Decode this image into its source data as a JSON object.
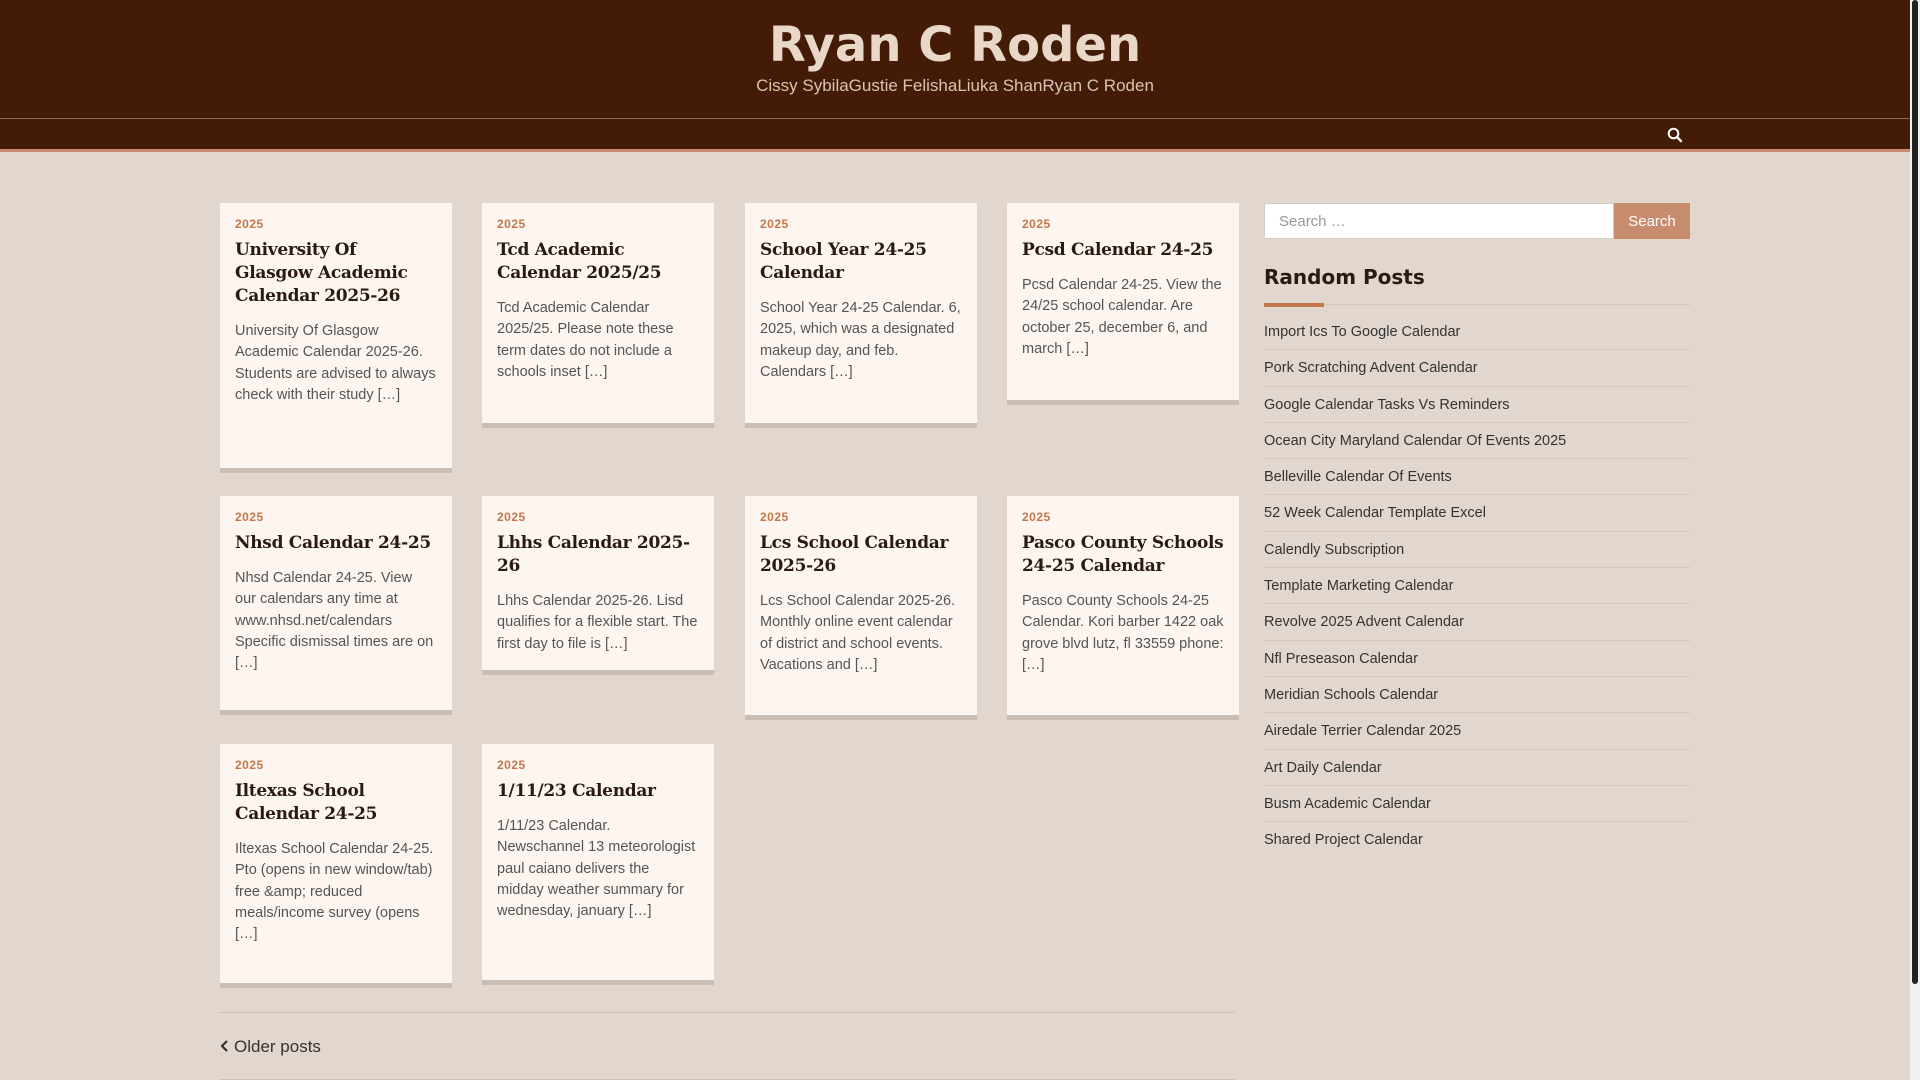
{
  "site": {
    "title": "Ryan C Roden",
    "description": "Cissy SybilaGustie FelishaLiuka ShanRyan C Roden"
  },
  "nav": {
    "search_icon": "search-icon"
  },
  "posts": [
    {
      "category": "2025",
      "title": "University Of Glasgow Academic Calendar 2025-26",
      "excerpt": "University Of Glasgow Academic Calendar 2025-26. Students are advised to always check with their study […]"
    },
    {
      "category": "2025",
      "title": "Tcd Academic Calendar 2025/25",
      "excerpt": "Tcd Academic Calendar 2025/25. Please note these term dates do not include a schools inset […]"
    },
    {
      "category": "2025",
      "title": "School Year 24-25 Calendar",
      "excerpt": "School Year 24-25 Calendar. 6, 2025, which was a designated makeup day, and feb. Calendars […]"
    },
    {
      "category": "2025",
      "title": "Pcsd Calendar 24-25",
      "excerpt": "Pcsd Calendar 24-25. View the 24/25 school calendar. Are october 25, december 6, and march […]"
    },
    {
      "category": "2025",
      "title": "Nhsd Calendar 24-25",
      "excerpt": "Nhsd Calendar 24-25. View our calendars any time at www.nhsd.net/calendars Specific dismissal times are on […]"
    },
    {
      "category": "2025",
      "title": "Lhhs Calendar 2025-26",
      "excerpt": "Lhhs Calendar 2025-26. Lisd qualifies for a flexible start. The first day to file is […]"
    },
    {
      "category": "2025",
      "title": "Lcs School Calendar 2025-26",
      "excerpt": "Lcs School Calendar 2025-26. Monthly online event calendar of district and school events. Vacations and […]"
    },
    {
      "category": "2025",
      "title": "Pasco County Schools 24-25 Calendar",
      "excerpt": "Pasco County Schools 24-25 Calendar. Kori barber 1422 oak grove blvd lutz, fl 33559 phone: […]"
    },
    {
      "category": "2025",
      "title": "Iltexas School Calendar 24-25",
      "excerpt": "Iltexas School Calendar 24-25. Pto (opens in new window/tab) free &amp; reduced meals/income survey (opens […]"
    },
    {
      "category": "2025",
      "title": "1/11/23 Calendar",
      "excerpt": "1/11/23 Calendar. Newschannel 13 meteorologist paul caiano delivers the midday weather summary for wednesday, january […]"
    }
  ],
  "pagination": {
    "older_label": "Older posts",
    "chevron_icon": "chevron-left-icon"
  },
  "sidebar": {
    "search": {
      "placeholder": "Search …",
      "button_label": "Search"
    },
    "random_posts_title": "Random Posts",
    "random_posts": [
      "Import Ics To Google Calendar",
      "Pork Scratching Advent Calendar",
      "Google Calendar Tasks Vs Reminders",
      "Ocean City Maryland Calendar Of Events 2025",
      "Belleville Calendar Of Events",
      "52 Week Calendar Template Excel",
      "Calendly Subscription",
      "Template Marketing Calendar",
      "Revolve 2025 Advent Calendar",
      "Nfl Preseason Calendar",
      "Meridian Schools Calendar",
      "Airedale Terrier Calendar 2025",
      "Art Daily Calendar",
      "Busm Academic Calendar",
      "Shared Project Calendar"
    ]
  },
  "colors": {
    "header_bg": "#441b06",
    "accent": "#c78c6d",
    "category": "#c4774a",
    "page_bg": "#e2d7ce",
    "card_bg": "#fdf5f0"
  }
}
